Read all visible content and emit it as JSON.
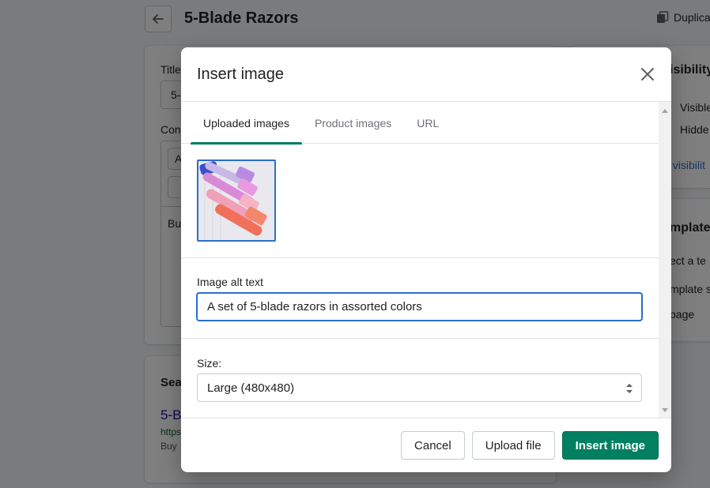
{
  "page": {
    "title": "5-Blade Razors",
    "duplicate_label": "Duplica",
    "title_label": "Title",
    "title_value": "5-",
    "content_label": "Con",
    "editor_partial": "A",
    "body_partial": "Bu",
    "visibility_heading": "isibility",
    "visible_option": "Visible",
    "hidden_option": "Hidde",
    "visibility_link": "t visibilit",
    "template_heading": "mplate",
    "template_text": "ect a te",
    "template_suffix": "mplate s",
    "template_value": "page",
    "seo_heading": "Sea",
    "seo_title": "5-B",
    "seo_url": "https",
    "seo_desc": "Buy"
  },
  "modal": {
    "title": "Insert image",
    "tabs": [
      {
        "label": "Uploaded images",
        "active": true
      },
      {
        "label": "Product images",
        "active": false
      },
      {
        "label": "URL",
        "active": false
      }
    ],
    "alt_label": "Image alt text",
    "alt_value": "A set of 5-blade razors in assorted colors",
    "size_label": "Size:",
    "size_value": "Large (480x480)",
    "buttons": {
      "cancel": "Cancel",
      "upload": "Upload file",
      "insert": "Insert image"
    }
  },
  "icons": {
    "back": "arrow-left-icon",
    "duplicate": "duplicate-icon",
    "close": "close-icon",
    "select": "select-arrows-icon"
  },
  "colors": {
    "primary": "#008060",
    "focus": "#2c6ecb",
    "overlay": "rgba(0,0,0,0.5)"
  }
}
